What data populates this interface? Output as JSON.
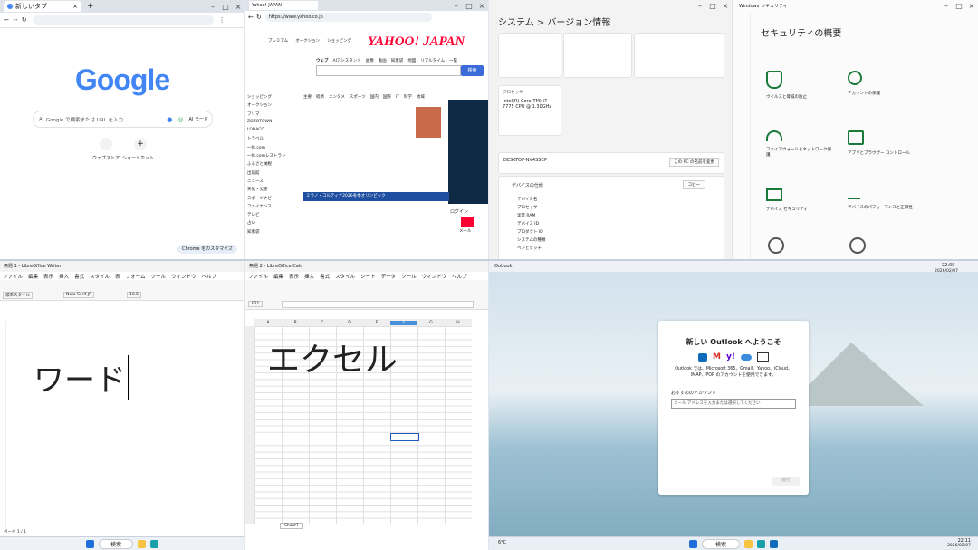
{
  "chrome": {
    "tab_title": "新しいタブ",
    "search_placeholder": "Google で検索または URL を入力",
    "logo": "Google",
    "shortcut_1": "ウェブストア",
    "shortcut_2": "ショートカット…",
    "customize": "Chrome をカスタマイズ"
  },
  "yahoo": {
    "tab_title": "Yahoo! JAPAN",
    "url": "https://www.yahoo.co.jp",
    "logo": "YAHOO! JAPAN",
    "search_button": "検索",
    "nav": [
      "プレミアム",
      "オークション",
      "ショッピング"
    ],
    "search_tabs": [
      "ウェブ",
      "AIアシスタント",
      "画像",
      "動画",
      "知恵袋",
      "地図",
      "リアルタイム",
      "一覧"
    ],
    "sidebar": [
      "ショッピング",
      "オークション",
      "フリマ",
      "ZOZOTOWN",
      "LOHACO",
      "トラベル",
      "一休.com",
      "一休.comレストラン",
      "ふるさと納税",
      "出前館",
      "ニュース",
      "天気・災害",
      "スポーツナビ",
      "ファイナンス",
      "テレビ",
      "占い",
      "知恵袋"
    ],
    "news_tabs": [
      "主要",
      "経済",
      "エンタメ",
      "スポーツ",
      "国内",
      "国際",
      "IT",
      "科学",
      "地域"
    ],
    "olympics": "ミラノ・コルティナ2026冬季オリンピック",
    "login": "ログイン",
    "mail": "メール"
  },
  "settings": {
    "title": "システム > バージョン情報",
    "processor_label": "プロセッサ",
    "processor_value": "Intel(R) Core(TM) i7-7775 CPU @ 1.30GHz",
    "device_name": "DESKTOP-NV4SSCP",
    "rename_button": "この PC の名前を変更",
    "device_spec_header": "デバイスの仕様",
    "copy_button": "コピー",
    "spec_labels": [
      "デバイス名",
      "プロセッサ",
      "実装 RAM",
      "デバイス ID",
      "プロダクト ID",
      "システムの種類",
      "ペンとタッチ"
    ]
  },
  "security": {
    "window_title": "Windows セキュリティ",
    "title": "セキュリティの概要",
    "items": [
      "ウイルスと脅威の防止",
      "アカウントの保護",
      "ファイアウォールとネットワーク保護",
      "アプリとブラウザー コントロール",
      "デバイス セキュリティ",
      "デバイスのパフォーマンスと正常性",
      "ファミリー オプション",
      "保護の履歴"
    ]
  },
  "writer": {
    "title": "無題 1 - LibreOffice Writer",
    "menus": [
      "ファイル",
      "編集",
      "表示",
      "挿入",
      "書式",
      "スタイル",
      "表",
      "フォーム",
      "ツール",
      "ウィンドウ",
      "ヘルプ"
    ],
    "style": "標準スタイル",
    "font": "Noto Serif JP",
    "size": "10.5",
    "text": "ワード",
    "status": "ページ 1 / 1"
  },
  "calc": {
    "title": "無題 2 - LibreOffice Calc",
    "menus": [
      "ファイル",
      "編集",
      "表示",
      "挿入",
      "書式",
      "スタイル",
      "シート",
      "データ",
      "ツール",
      "ウィンドウ",
      "ヘルプ"
    ],
    "name_box": "F21",
    "columns": [
      "A",
      "B",
      "C",
      "D",
      "E",
      "F",
      "G",
      "H"
    ],
    "text": "エクセル",
    "sheet_tab": "Sheet1"
  },
  "outlook": {
    "window_title": "Outlook",
    "title": "新しい Outlook へようこそ",
    "description": "Outlook では、Microsoft 365、Gmail、Yahoo、iCloud、IMAP、POP のアカウントを使用できます。",
    "account_label": "おすすめのアカウント",
    "account_input": "メール アドレスを入力または選択してください",
    "continue": "続行"
  },
  "taskbar": {
    "search": "検索",
    "time_1": "22:09",
    "date_1": "2026/02/07",
    "time_2": "22:11",
    "date_2": "2026/02/07",
    "weather": "6°C"
  }
}
